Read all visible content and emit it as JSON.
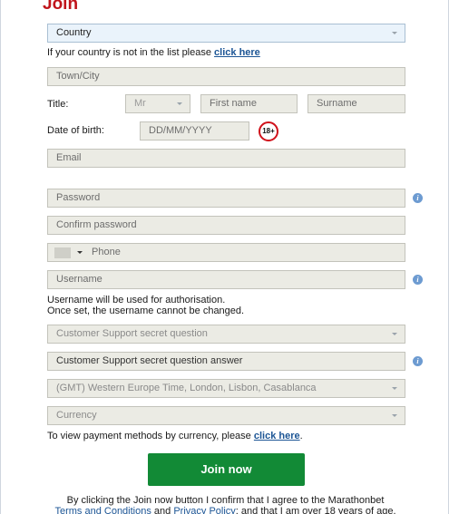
{
  "form": {
    "title": "Join",
    "country": {
      "value": "Country"
    },
    "country_hint": {
      "text": "If your country is not in the list please ",
      "link": "click here"
    },
    "town": {
      "placeholder": "Town/City"
    },
    "title_row": {
      "label": "Title:",
      "title_value": "Mr",
      "first_name": "First name",
      "surname": "Surname"
    },
    "dob": {
      "label": "Date of birth:",
      "placeholder": "DD/MM/YYYY",
      "age_badge": "18+"
    },
    "email": {
      "placeholder": "Email"
    },
    "password": {
      "placeholder": "Password"
    },
    "confirm_password": {
      "placeholder": "Confirm password"
    },
    "phone": {
      "placeholder": "Phone"
    },
    "username": {
      "placeholder": "Username"
    },
    "username_note": {
      "line1": "Username will be used for authorisation.",
      "line2": "Once set, the username cannot be changed."
    },
    "secret_question": {
      "value": "Customer Support secret question"
    },
    "secret_answer": {
      "placeholder": "Customer Support secret question answer"
    },
    "timezone": {
      "value": "(GMT) Western Europe Time, London, Lisbon, Casablanca"
    },
    "currency": {
      "value": "Currency"
    },
    "payment_hint": {
      "text": "To view payment methods by currency, please ",
      "link": "click here",
      "end": "."
    },
    "submit_label": "Join now",
    "consent": {
      "line1": "By clicking the Join now button I confirm that I agree to the Marathonbet",
      "terms": "Terms and Conditions",
      "and": " and ",
      "privacy": "Privacy Policy",
      "tail": "; and that I am over 18 years of age."
    }
  },
  "icons": {
    "info": "info-icon",
    "caret": "chevron-down-icon"
  },
  "colors": {
    "accent": "#c0141b",
    "button": "#128a36",
    "link": "#1c5595"
  }
}
